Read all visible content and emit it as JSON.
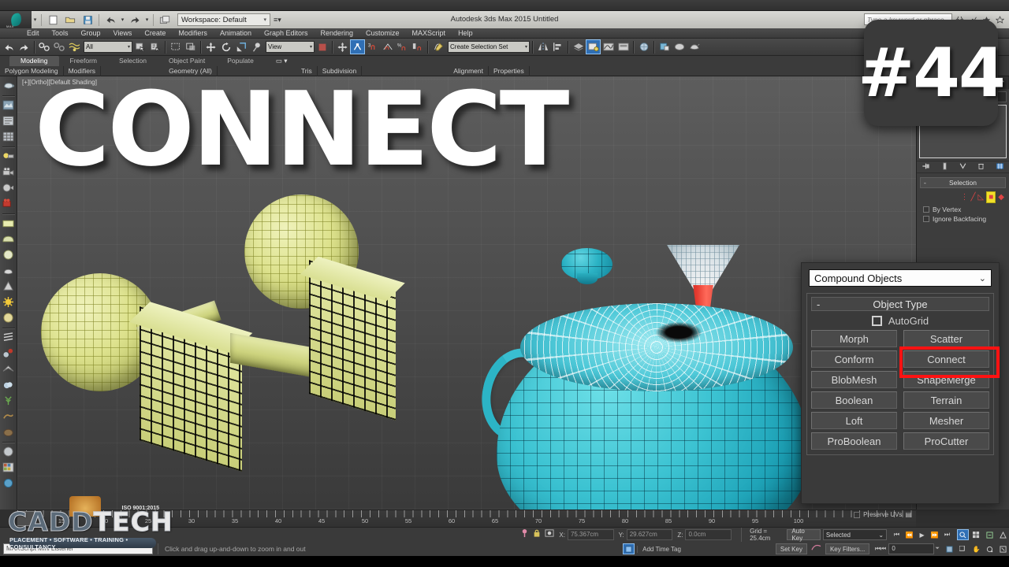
{
  "app": {
    "title": "Autodesk 3ds Max  2015    Untitled",
    "workspace_label": "Workspace: Default",
    "search_placeholder": "Type a keyword or phrase"
  },
  "menu": {
    "items": [
      "Edit",
      "Tools",
      "Group",
      "Views",
      "Create",
      "Modifiers",
      "Animation",
      "Graph Editors",
      "Rendering",
      "Customize",
      "MAXScript",
      "Help"
    ]
  },
  "toolbar": {
    "filter_combo": "All",
    "reference_combo": "View",
    "selection_set_combo": "Create Selection Set"
  },
  "ribbon": {
    "tabs": [
      "Modeling",
      "Freeform",
      "Selection",
      "Object Paint",
      "Populate"
    ],
    "selected_tab": "Modeling",
    "panels": [
      "Polygon Modeling",
      "Modifiers",
      "Geometry (All)",
      "Tris",
      "Subdivision",
      "Alignment",
      "Properties"
    ]
  },
  "viewport": {
    "label": "[+][Ortho][Default Shading]",
    "overlay_title": "CONNECT",
    "badge": "#44"
  },
  "command_panel": {
    "rollout_title": "Selection",
    "checkbox_by_vertex": "By Vertex",
    "checkbox_ignore_backfacing": "Ignore Backfacing"
  },
  "compound_panel": {
    "category": "Compound Objects",
    "rollout_title": "Object Type",
    "autogrid_label": "AutoGrid",
    "buttons": [
      "Morph",
      "Scatter",
      "Conform",
      "Connect",
      "BlobMesh",
      "ShapeMerge",
      "Boolean",
      "Terrain",
      "Loft",
      "Mesher",
      "ProBoolean",
      "ProCutter"
    ],
    "highlighted_button": "Connect",
    "highlight_color": "#ff1212"
  },
  "timeline": {
    "labels": [
      "15",
      "20",
      "25",
      "30",
      "35",
      "40",
      "45",
      "50",
      "55",
      "60",
      "65",
      "70",
      "75",
      "80",
      "85",
      "90",
      "95",
      "100"
    ]
  },
  "status": {
    "x_label": "X:",
    "x_value": "75.367cm",
    "y_label": "Y:",
    "y_value": "29.627cm",
    "z_label": "Z:",
    "z_value": "0.0cm",
    "grid": "Grid = 25.4cm",
    "message": "Click and drag up-and-down to zoom in and out",
    "prompt": "MAXScript Mini Listener",
    "add_time_tag": "Add Time Tag",
    "auto_key": "Auto Key",
    "set_key": "Set Key",
    "key_filters": "Key Filters...",
    "key_mode_combo": "Selected",
    "frame_value": "0",
    "preserve_uvs": "Preserve UVs"
  },
  "logo": {
    "name_cadd": "CADD",
    "name_tech": "TECH",
    "iso": "ISO 9001:2015",
    "tagline": "PLACEMENT • SOFTWARE • TRAINING • CONSULTANCY"
  }
}
